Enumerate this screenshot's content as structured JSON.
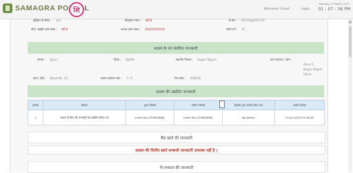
{
  "header": {
    "brand": "SAMAGRA PORTAL",
    "welcome": "Welcome: Guest",
    "login": "Login",
    "date": "Monday,17 March 2017",
    "time": "01 : 07 : 36 PM"
  },
  "basic": {
    "row1": [
      {
        "label": "मुखिया के संबंध :",
        "value": "Son"
      },
      {
        "label": "मोबाइल नम्बर :",
        "value": "नहीं है"
      },
      {
        "label": "ई-मेल :",
        "value": "XXXXX@XXX.XX"
      }
    ],
    "row2": [
      {
        "label": "वोटर आईडी कार्ड नम्बर :",
        "value": "नहीं है"
      },
      {
        "label": "आधार कार्ड नम्बर :",
        "value": "XXXXXXXXXX"
      },
      {
        "label": "जाति वर्ग :",
        "value": "SC"
      }
    ]
  },
  "address": {
    "title": "सदस्य के पते संबंधित जानकारी",
    "row1": [
      {
        "label": "संभाग :",
        "value": "Ujjain"
      },
      {
        "label": "ज़िला :",
        "value": "UJJAIN"
      },
      {
        "label": "स्थानीय निकाय :",
        "value": "Nagar Nigam"
      },
      {
        "label": "ग्राम पंचायत / ज़ोन :",
        "value": "Zone 5, Nagar Nigam Ujjain"
      }
    ],
    "row2": [
      {
        "label": "ग्राम / वॉर्ड :",
        "value": "Ward No. 25"
      },
      {
        "label": "मकान क्रमांक नंबर :",
        "value": "7 / 5"
      },
      {
        "label": "पिन कोड :",
        "value": "456006"
      }
    ]
  },
  "updates": {
    "title": "सदस्य की अद्यतित जानकारी",
    "columns": [
      "क्रमांक",
      "विवरण",
      "पुराना रिकॉर्ड",
      "वर्तमान रिकॉर्ड",
      "किसके द्वारा अपडेट किया गया",
      "अपडेट दिनांक"
    ],
    "rows": [
      [
        "1",
        "सदस्य के पिता की जानकारी को अद्यतित किया गया",
        "Lemil No (135962686)",
        "Lemil No (135962686)",
        "No Admin",
        "13 Jun 2014 01:36:49"
      ]
    ]
  },
  "bank": {
    "title": "बैंक खाते की जानकारी",
    "message": "सदस्य की वित्तीय खाते सम्बन्धी जानकारी उपलब्ध नहीं है |"
  },
  "disability": {
    "title": "नि:शक्तता की जानकारी"
  }
}
